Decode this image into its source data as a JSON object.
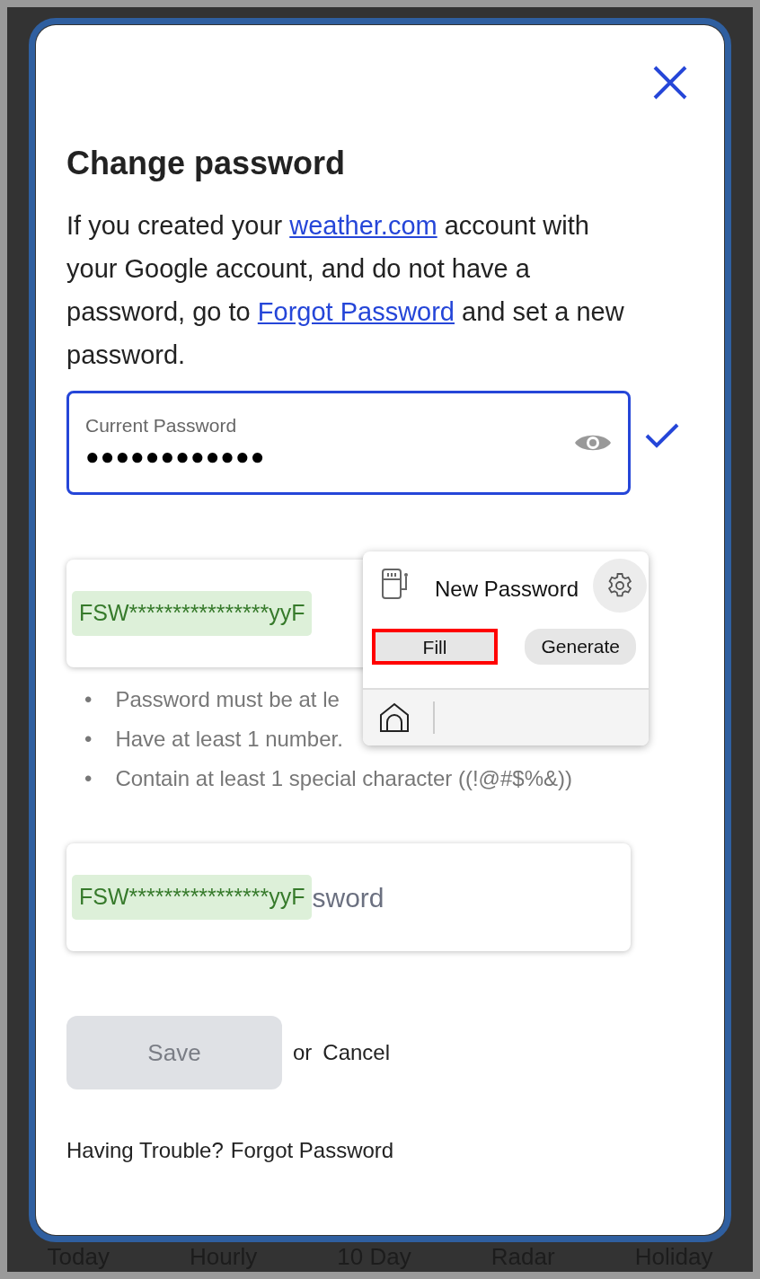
{
  "background_tabs": [
    "Today",
    "Hourly",
    "10 Day",
    "Radar",
    "Holiday"
  ],
  "modal": {
    "title": "Change password",
    "intro": [
      {
        "kind": "text",
        "text": "If you created your "
      },
      {
        "kind": "link",
        "text": "weather.com"
      },
      {
        "kind": "text",
        "text": " account with your Google account, and do not have a password, go to "
      },
      {
        "kind": "link",
        "text": "Forgot Password"
      },
      {
        "kind": "text",
        "text": " and set a new password."
      }
    ],
    "current_password": {
      "label": "Current Password",
      "value": "●●●●●●●●●●●●",
      "focused": true,
      "valid": true
    },
    "new_password": {
      "autofill": "FSW****************yyF"
    },
    "requirements": [
      {
        "bullet": "•",
        "text": "Password must be at le"
      },
      {
        "bullet": "•",
        "text": "Have at least 1 number."
      },
      {
        "bullet": "•",
        "text": "Contain at least 1 special character ((!@#$%&))"
      }
    ],
    "confirm_password": {
      "autofill": "FSW****************yyF",
      "placeholder": "sword"
    },
    "save": {
      "label": "Save",
      "disabled": true
    },
    "or_text": "or",
    "cancel": "Cancel",
    "trouble_text": "Having Trouble?",
    "trouble_link": "Forgot Password"
  },
  "popup": {
    "title": "New Password",
    "buttons": [
      {
        "label": "Fill",
        "highlighted": true
      },
      {
        "label": "Generate",
        "highlighted": false
      }
    ]
  }
}
